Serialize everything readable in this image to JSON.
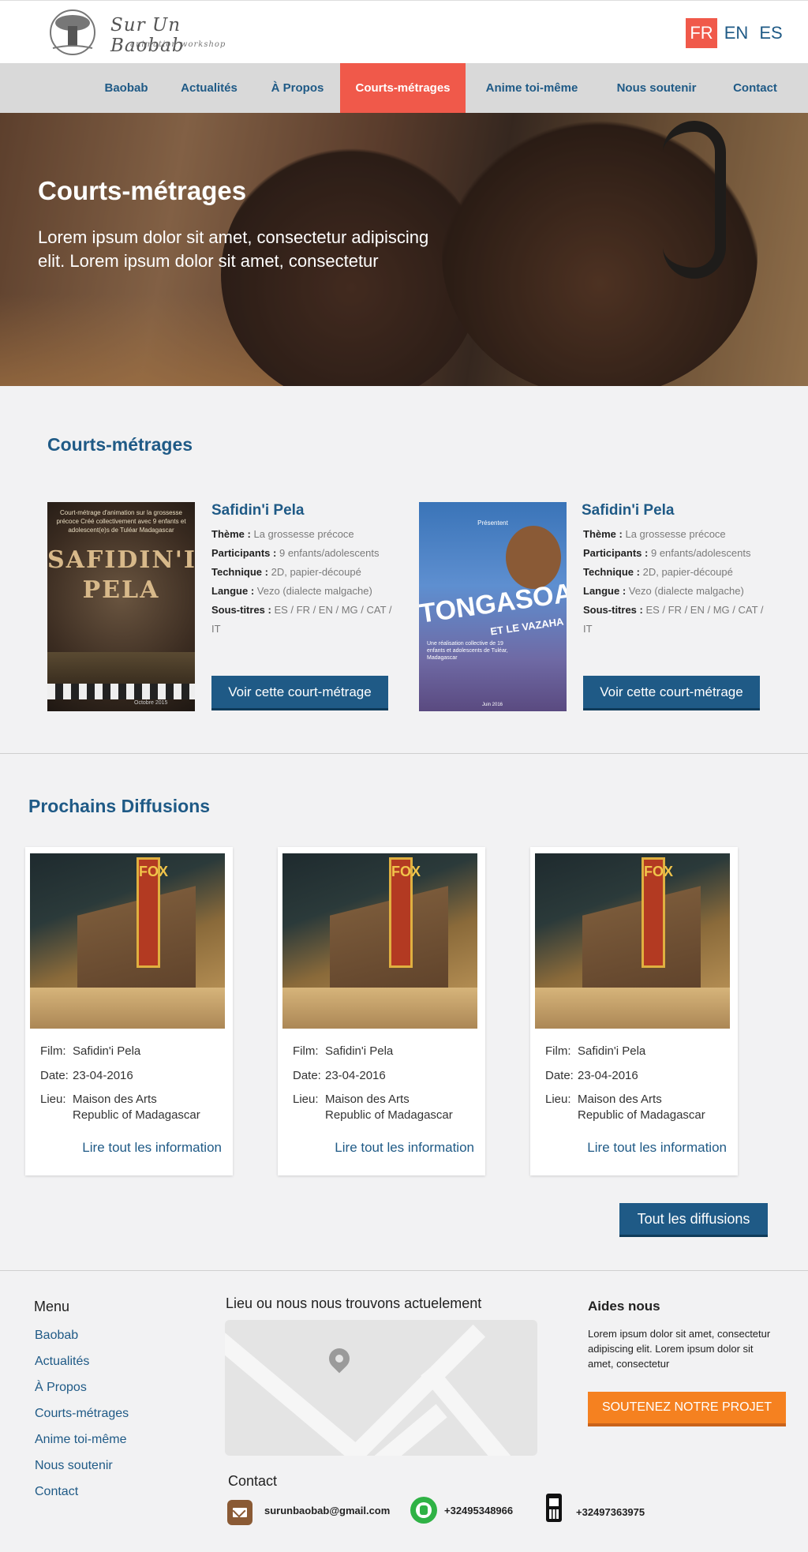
{
  "logo": {
    "title": "Sur Un Baobab",
    "subtitle": "animation workshop"
  },
  "languages": [
    "FR",
    "EN",
    "ES"
  ],
  "nav": [
    "Baobab",
    "Actualités",
    "À Propos",
    "Courts-métrages",
    "Anime toi-même",
    "Nous soutenir",
    "Contact"
  ],
  "hero": {
    "title": "Courts-métrages",
    "text": "Lorem ipsum dolor sit amet, consectetur adipiscing elit. Lorem ipsum dolor sit amet, consectetur"
  },
  "films_section": {
    "title": "Courts-métrages",
    "labels": {
      "theme": "Thème :",
      "participants": "Participants :",
      "technique": "Technique :",
      "langue": "Langue :",
      "soustitres": "Sous-titres :"
    },
    "button": "Voir cette court-métrage",
    "films": [
      {
        "title": "Safidin'i Pela",
        "theme": "La grossesse précoce",
        "participants": "9 enfants/adolescents",
        "technique": "2D, papier-découpé",
        "langue": "Vezo (dialecte malgache)",
        "soustitres": "ES / FR / EN / MG / CAT / IT",
        "poster": {
          "top_text": "Court-métrage d'animation sur la grossesse précoce Créé collectivement avec 9 enfants et adolescent(e)s de Tuléar Madagascar",
          "title_line1": "SAFIDIN'I",
          "title_line2": "PELA",
          "date": "Octobre 2015"
        }
      },
      {
        "title": "Safidin'i Pela",
        "theme": "La grossesse précoce",
        "participants": "9 enfants/adolescents",
        "technique": "2D, papier-découpé",
        "langue": "Vezo (dialecte malgache)",
        "soustitres": "ES / FR / EN / MG / CAT / IT",
        "poster": {
          "top_text": "Présentent",
          "title": "TONGASOA",
          "subtitle": "ET LE VAZAHA",
          "text": "Une réalisation collective de 19 enfants et adolescents de Tuléar, Madagascar",
          "date": "Juin 2016"
        }
      }
    ]
  },
  "diffusions": {
    "title": "Prochains Diffusions",
    "labels": {
      "film": "Film:",
      "date": "Date:",
      "lieu": "Lieu:"
    },
    "link": "Lire tout les information",
    "image_sign": "FOX",
    "cards": [
      {
        "film": "Safidin'i Pela",
        "date": "23-04-2016",
        "lieu_line1": "Maison des Arts",
        "lieu_line2": "Republic of Madagascar"
      },
      {
        "film": "Safidin'i Pela",
        "date": "23-04-2016",
        "lieu_line1": "Maison des Arts",
        "lieu_line2": "Republic of Madagascar"
      },
      {
        "film": "Safidin'i Pela",
        "date": "23-04-2016",
        "lieu_line1": "Maison des Arts",
        "lieu_line2": "Republic of Madagascar"
      }
    ],
    "all_button": "Tout les diffusions"
  },
  "footer": {
    "menu_title": "Menu",
    "menu": [
      "Baobab",
      "Actualités",
      "À Propos",
      "Courts-métrages",
      "Anime toi-même",
      "Nous soutenir",
      "Contact"
    ],
    "map_title": "Lieu ou nous nous trouvons actuelement",
    "aides_title": "Aides nous",
    "aides_text": "Lorem ipsum dolor sit amet, consectetur adipiscing elit. Lorem ipsum dolor sit amet, consectetur",
    "aides_button": "SOUTENEZ NOTRE PROJET",
    "contact_title": "Contact",
    "email": "surunbaobab@gmail.com",
    "whatsapp": "+32495348966",
    "phone": "+32497363975"
  },
  "colors": {
    "primary": "#1f5a86",
    "accent": "#f0594a",
    "support": "#f58120",
    "background": "#f2f2f3"
  }
}
